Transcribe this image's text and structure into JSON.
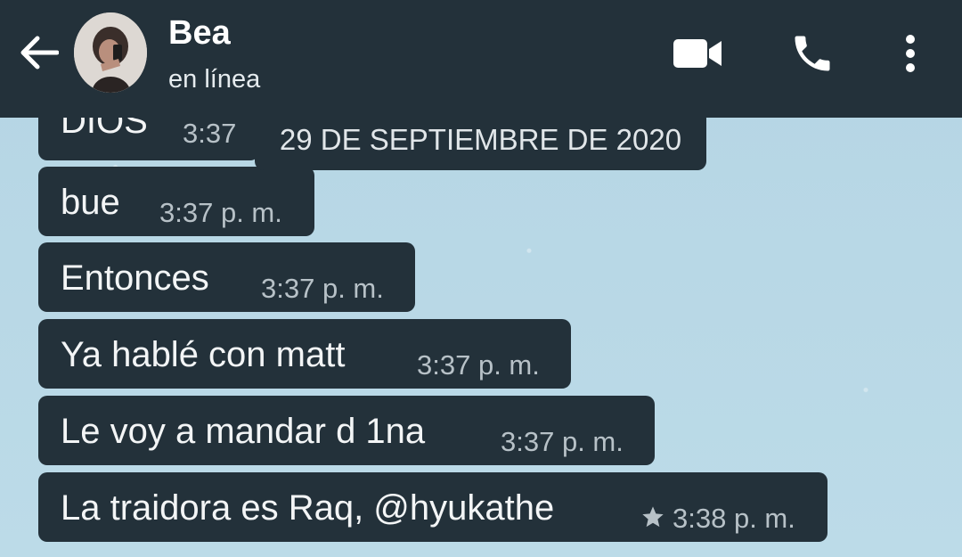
{
  "header": {
    "contact_name": "Bea",
    "status": "en línea",
    "icons": [
      "back-arrow-icon",
      "video-call-icon",
      "phone-icon",
      "more-vert-icon"
    ]
  },
  "date_chip": "29 DE SEPTIEMBRE DE 2020",
  "messages": [
    {
      "text": "DIOS",
      "time": "3:37"
    },
    {
      "text": "bue",
      "time": "3:37 p. m."
    },
    {
      "text": "Entonces",
      "time": "3:37 p. m."
    },
    {
      "text": "Ya hablé con matt",
      "time": "3:37 p. m."
    },
    {
      "text": "Le voy a mandar d 1na",
      "time": "3:37 p. m."
    },
    {
      "text": "La traidora es Raq, @hyukathe",
      "time": "3:38 p. m.",
      "starred": true
    }
  ],
  "colors": {
    "header_bg": "#23313a",
    "bubble_bg": "#23313a",
    "chat_bg": "#b8d7e6",
    "time_text": "#b7c1c7"
  }
}
